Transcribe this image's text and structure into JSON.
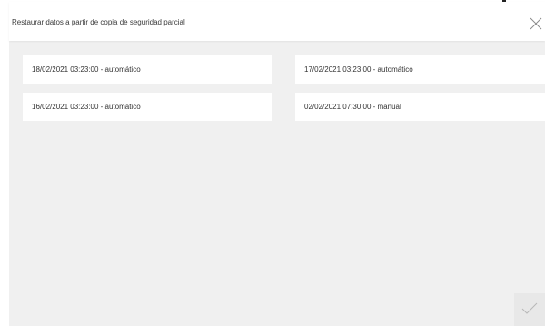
{
  "dialog": {
    "title": "Restaurar datos a partir de copia de seguridad parcial",
    "close_icon": "close-icon",
    "confirm_icon": "check-icon"
  },
  "backups": [
    {
      "label": "18/02/2021 03:23:00 - automático"
    },
    {
      "label": "17/02/2021 03:23:00 - automático"
    },
    {
      "label": "16/02/2021 03:23:00 - automático"
    },
    {
      "label": "02/02/2021 07:30:00 - manual"
    }
  ],
  "colors": {
    "background": "#f0f0f0",
    "card": "#ffffff",
    "text": "#333333",
    "icon": "#9a9a9a"
  }
}
